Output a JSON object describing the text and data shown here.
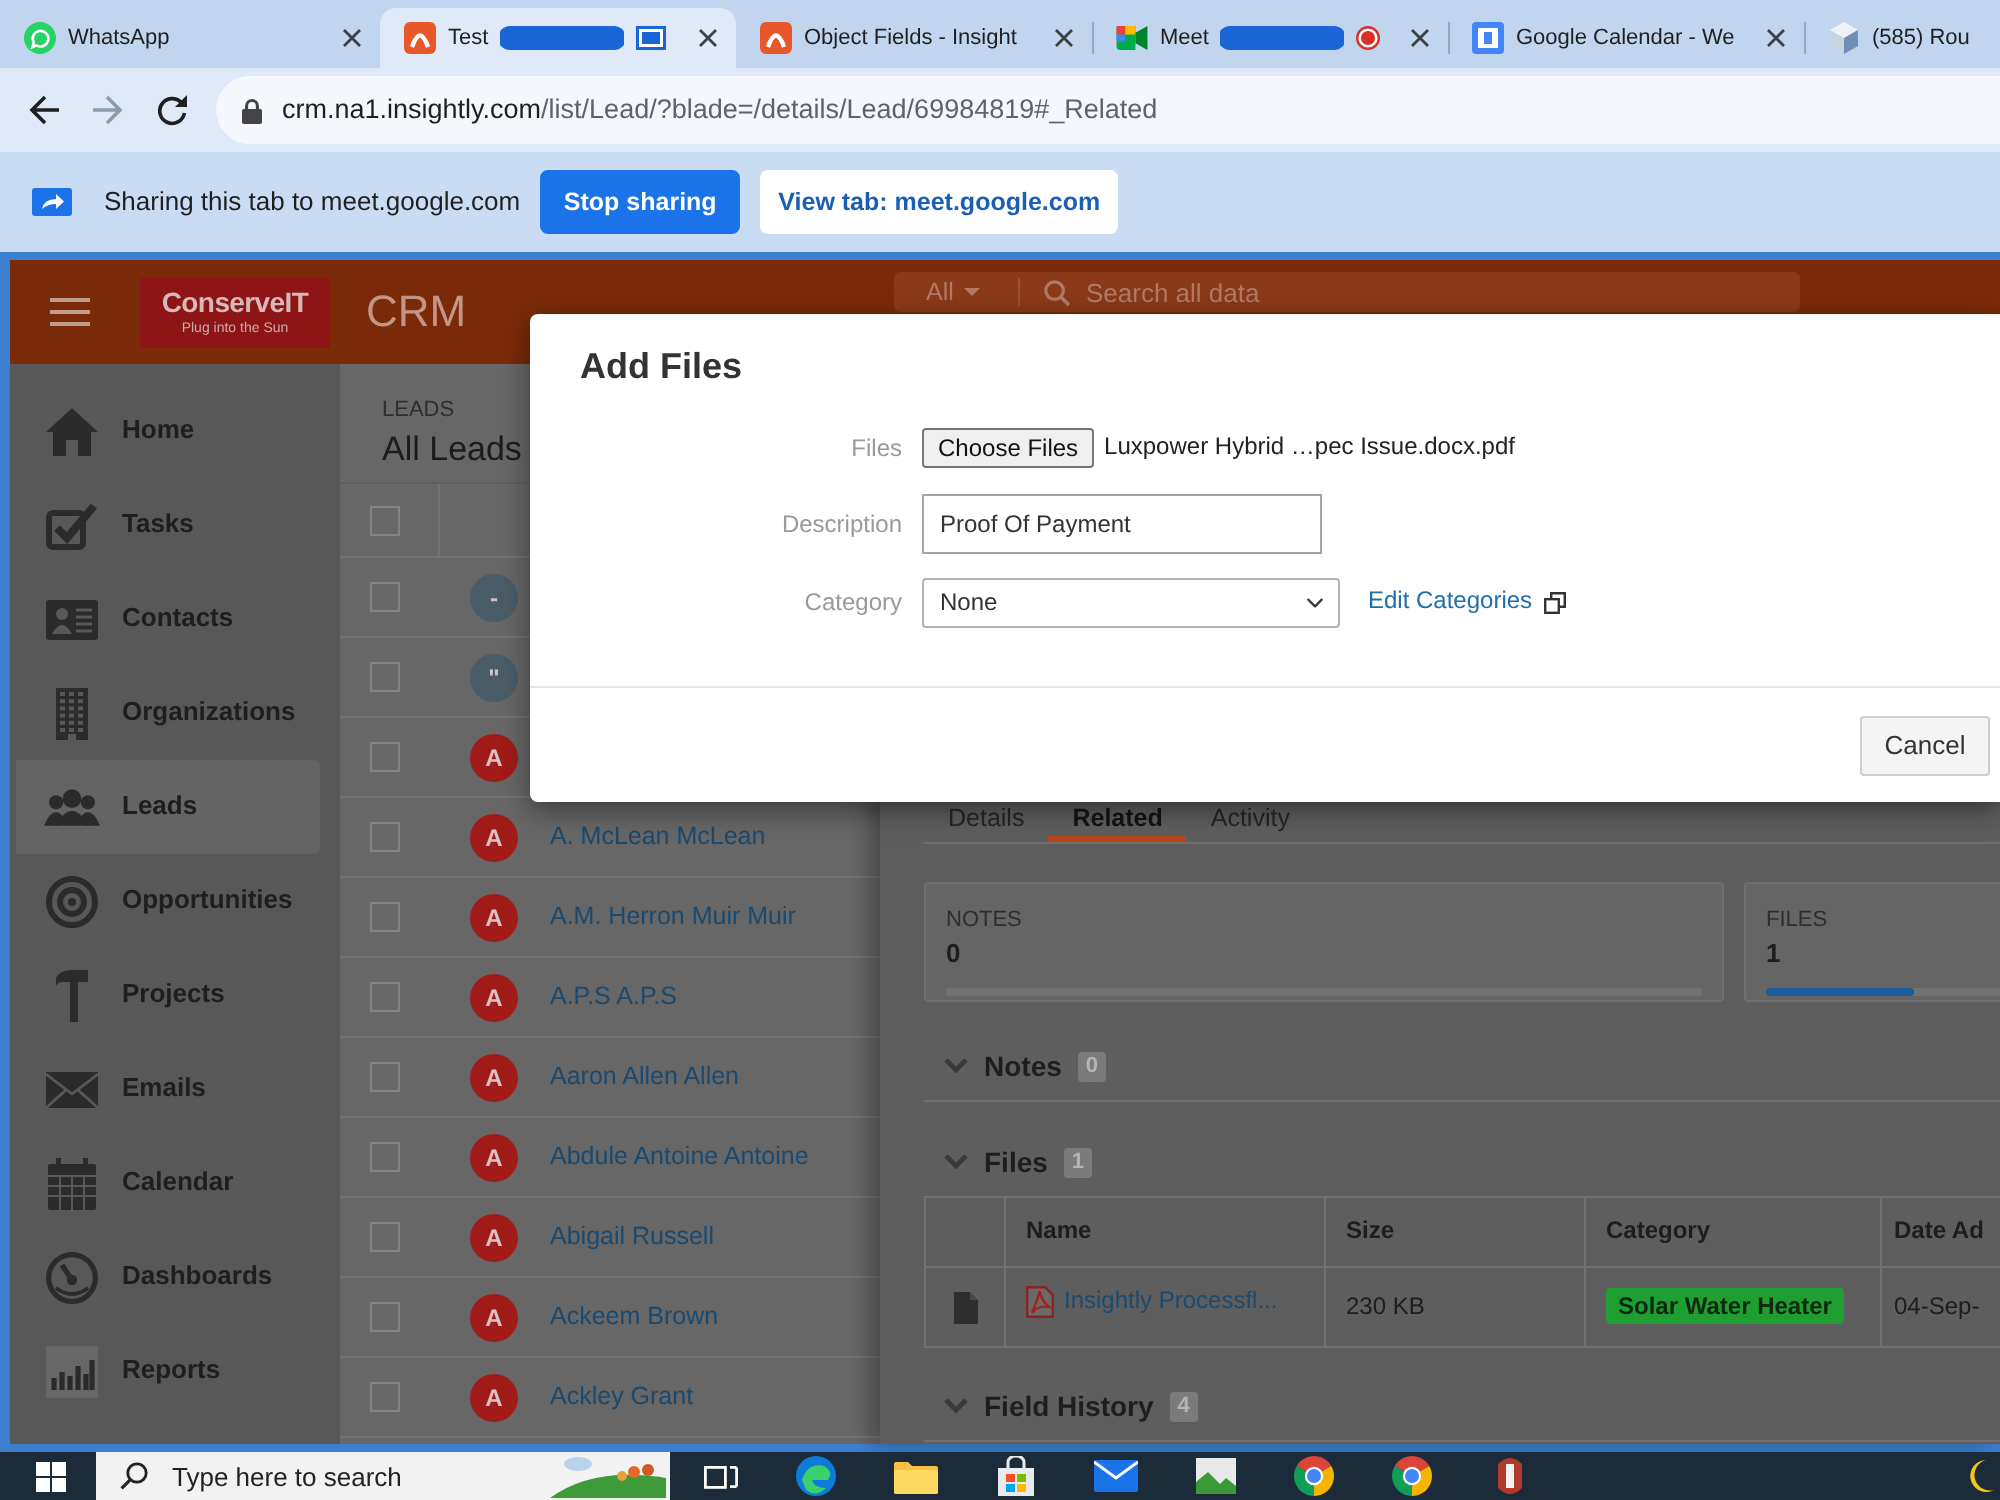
{
  "browser": {
    "tabs": [
      {
        "title": "WhatsApp",
        "selected": false,
        "redacted": false,
        "sharing": false,
        "recording": false
      },
      {
        "title": "Test",
        "selected": true,
        "redacted": true,
        "sharing": true,
        "recording": false
      },
      {
        "title": "Object Fields - Insight",
        "selected": false,
        "redacted": false,
        "sharing": false,
        "recording": false
      },
      {
        "title": "Meet",
        "selected": false,
        "redacted": true,
        "sharing": false,
        "recording": true
      },
      {
        "title": "Google Calendar - We",
        "selected": false,
        "redacted": false,
        "sharing": false,
        "recording": false
      },
      {
        "title": "(585) Rou",
        "selected": false,
        "redacted": false,
        "sharing": false,
        "recording": false
      }
    ],
    "nav": [
      {
        "kind": "back",
        "disabled": false
      },
      {
        "kind": "forward",
        "disabled": true
      },
      {
        "kind": "reload",
        "disabled": false
      }
    ],
    "address": {
      "host": "crm.na1.insightly.com",
      "path": "/list/Lead/?blade=/details/Lead/69984819#_Related"
    },
    "share_bar": {
      "message": "Sharing this tab to meet.google.com",
      "buttons": [
        {
          "label": "Stop sharing",
          "kind": "primary"
        },
        {
          "label": "View tab: meet.google.com",
          "kind": "secondary"
        }
      ]
    }
  },
  "app_header": {
    "logo": {
      "wordmark": "ConserveIT",
      "tagline": "Plug into the Sun"
    },
    "title": "CRM",
    "search": {
      "scope": "All",
      "placeholder": "Search all data"
    }
  },
  "sidebar": {
    "items": [
      {
        "label": "Home",
        "selected": false
      },
      {
        "label": "Tasks",
        "selected": false
      },
      {
        "label": "Contacts",
        "selected": false
      },
      {
        "label": "Organizations",
        "selected": false
      },
      {
        "label": "Leads",
        "selected": true
      },
      {
        "label": "Opportunities",
        "selected": false
      },
      {
        "label": "Projects",
        "selected": false
      },
      {
        "label": "Emails",
        "selected": false
      },
      {
        "label": "Calendar",
        "selected": false
      },
      {
        "label": "Dashboards",
        "selected": false
      },
      {
        "label": "Reports",
        "selected": false
      }
    ]
  },
  "list": {
    "caption": "LEADS",
    "title": "All Leads",
    "select_all_checked": false,
    "rows": [
      {
        "initial": "-",
        "color": "#4a5c67",
        "checked": false
      },
      {
        "initial": "\"",
        "color": "#4a5c67",
        "checked": false
      },
      {
        "initial": "A",
        "color": "#a11b18",
        "checked": false
      },
      {
        "initial": "A",
        "name": "A. McLean McLean",
        "color": "#a11b18",
        "checked": false
      },
      {
        "initial": "A",
        "name": "A.M. Herron Muir Muir",
        "color": "#a11b18",
        "checked": false
      },
      {
        "initial": "A",
        "name": "A.P.S A.P.S",
        "color": "#a11b18",
        "checked": false
      },
      {
        "initial": "A",
        "name": "Aaron Allen Allen",
        "color": "#a11b18",
        "checked": false
      },
      {
        "initial": "A",
        "name": "Abdule Antoine Antoine",
        "color": "#a11b18",
        "checked": false
      },
      {
        "initial": "A",
        "name": "Abigail Russell",
        "color": "#a11b18",
        "checked": false
      },
      {
        "initial": "A",
        "name": "Ackeem Brown",
        "color": "#a11b18",
        "checked": false
      },
      {
        "initial": "A",
        "name": "Ackley Grant",
        "color": "#a11b18",
        "checked": false
      }
    ]
  },
  "details": {
    "tabs": [
      {
        "label": "Details",
        "selected": false
      },
      {
        "label": "Related",
        "selected": true
      },
      {
        "label": "Activity",
        "selected": false
      }
    ],
    "summary": [
      {
        "label": "NOTES",
        "count": "0"
      },
      {
        "label": "FILES",
        "count": "1",
        "level": 0.63
      }
    ],
    "sections": [
      {
        "title": "Notes",
        "count": "0",
        "expanded": true
      },
      {
        "title": "Files",
        "count": "1",
        "expanded": true,
        "table": {
          "columns": [
            "Name",
            "Size",
            "Category",
            "Date Ad"
          ],
          "rows": [
            {
              "name": "Insightly Processfl...",
              "size": "230 KB",
              "category": "Solar Water Heater",
              "color": "#1f9e31",
              "date": "04-Sep-"
            }
          ]
        }
      },
      {
        "title": "Field History",
        "count": "4",
        "expanded": true
      }
    ]
  },
  "dialog": {
    "title": "Add Files",
    "fields": [
      {
        "kind": "file",
        "label": "Files",
        "button": "Choose Files",
        "value": "Luxpower Hybrid …pec Issue.docx.pdf"
      },
      {
        "kind": "text",
        "label": "Description",
        "value": "Proof Of Payment"
      },
      {
        "kind": "select",
        "label": "Category",
        "value": "None",
        "link": "Edit Categories"
      }
    ],
    "buttons": [
      "Cancel"
    ]
  },
  "taskbar": {
    "search": {
      "placeholder": "Type here to search"
    }
  }
}
